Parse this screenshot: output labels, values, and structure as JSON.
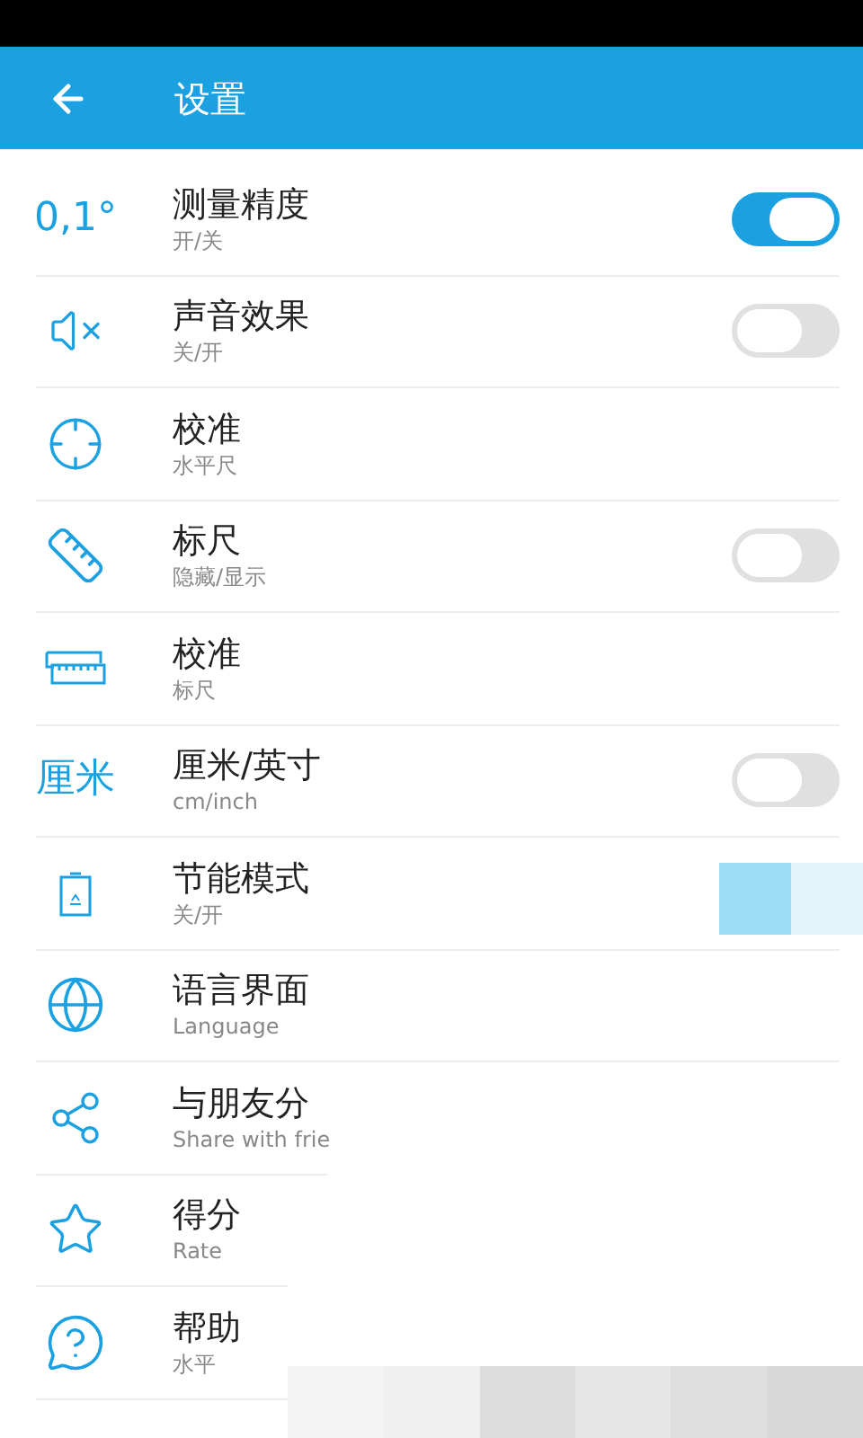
{
  "header": {
    "title": "设置"
  },
  "items": [
    {
      "icon_text": "0,1°",
      "title": "测量精度",
      "subtitle": "开/关",
      "kind": "toggle",
      "on": true
    },
    {
      "title": "声音效果",
      "subtitle": "关/开",
      "kind": "toggle",
      "on": false
    },
    {
      "title": "校准",
      "subtitle": "水平尺",
      "kind": "link"
    },
    {
      "title": "标尺",
      "subtitle": "隐藏/显示",
      "kind": "toggle",
      "on": false
    },
    {
      "title": "校准",
      "subtitle": "标尺",
      "kind": "link"
    },
    {
      "icon_text": "厘米",
      "title": "厘米/英寸",
      "subtitle": "cm/inch",
      "kind": "toggle",
      "on": false
    },
    {
      "title": "节能模式",
      "subtitle": "关/开",
      "kind": "link"
    },
    {
      "title": "语言界面",
      "subtitle": "Language",
      "kind": "link"
    },
    {
      "title": "与朋友分",
      "subtitle": "Share with frie",
      "kind": "link"
    },
    {
      "title": "得分",
      "subtitle": "Rate",
      "kind": "link"
    },
    {
      "title": "帮助",
      "subtitle": "水平",
      "kind": "link"
    }
  ]
}
